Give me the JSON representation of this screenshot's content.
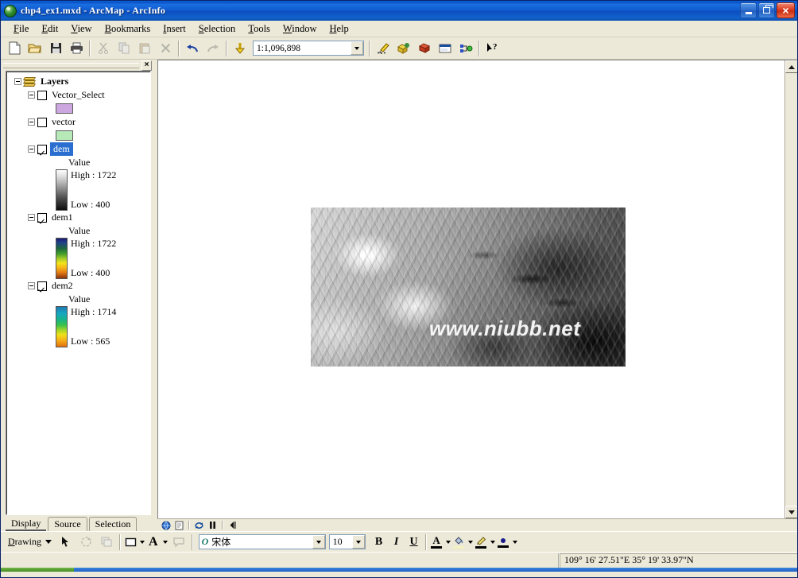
{
  "window": {
    "title": "chp4_ex1.mxd - ArcMap - ArcInfo",
    "icon": "arcmap-globe-icon",
    "minimize_label": "",
    "maximize_label": "",
    "close_label": "×"
  },
  "menubar": {
    "items": [
      {
        "label": "File",
        "accel": "F"
      },
      {
        "label": "Edit",
        "accel": "E"
      },
      {
        "label": "View",
        "accel": "V"
      },
      {
        "label": "Bookmarks",
        "accel": "B"
      },
      {
        "label": "Insert",
        "accel": "I"
      },
      {
        "label": "Selection",
        "accel": "S"
      },
      {
        "label": "Tools",
        "accel": "T"
      },
      {
        "label": "Window",
        "accel": "W"
      },
      {
        "label": "Help",
        "accel": "H"
      }
    ]
  },
  "toolbar": {
    "buttons": [
      {
        "name": "new-document-icon",
        "title": "New"
      },
      {
        "name": "open-folder-icon",
        "title": "Open"
      },
      {
        "name": "save-icon",
        "title": "Save"
      },
      {
        "name": "print-icon",
        "title": "Print"
      },
      {
        "name": "cut-icon",
        "title": "Cut"
      },
      {
        "name": "copy-icon",
        "title": "Copy"
      },
      {
        "name": "paste-icon",
        "title": "Paste"
      },
      {
        "name": "delete-icon",
        "title": "Delete"
      },
      {
        "name": "undo-icon",
        "title": "Undo"
      },
      {
        "name": "redo-icon",
        "title": "Redo"
      },
      {
        "name": "add-data-icon",
        "title": "Add Data"
      }
    ],
    "scale": {
      "label": "map-scale-combo",
      "value": "1:1,096,898"
    },
    "right_buttons": [
      {
        "name": "editor-toolbar-icon",
        "title": "Editor Toolbar"
      },
      {
        "name": "arctoolbox-icon",
        "title": "Show/Hide ArcToolbox Window"
      },
      {
        "name": "command-line-icon",
        "title": "Show/Hide Command Line Window"
      },
      {
        "name": "model-builder-icon",
        "title": "ModelBuilder"
      },
      {
        "name": "whats-this-icon",
        "title": "What's This?"
      }
    ]
  },
  "toc": {
    "close_label": "×",
    "root": {
      "label": "Layers",
      "icon": "layers-icon",
      "expanded": true
    },
    "layers": [
      {
        "name": "Vector_Select",
        "checked": false,
        "selected": false,
        "legend_type": "swatch",
        "swatch_color": "#cda8e0"
      },
      {
        "name": "vector",
        "checked": false,
        "selected": false,
        "legend_type": "swatch",
        "swatch_color": "#b6e8b8"
      },
      {
        "name": "dem",
        "checked": true,
        "selected": true,
        "legend_type": "ramp",
        "value_label": "Value",
        "high_label": "High : 1722",
        "low_label": "Low  : 400",
        "ramp_css": "linear-gradient(180deg,#ffffff 0%,#d9d9d9 18%,#9a9a9a 42%,#4e4e4e 70%,#0d0d0d 100%)"
      },
      {
        "name": "dem1",
        "checked": true,
        "selected": false,
        "legend_type": "ramp",
        "value_label": "Value",
        "high_label": "High : 1722",
        "low_label": "Low  : 400",
        "ramp_css": "linear-gradient(180deg,#1b1b6e 0%,#20408c 10%,#1f6b3a 26%,#3f9c2a 38%,#9ec92a 50%,#f2e41a 62%,#f5b418 74%,#e07a14 86%,#8a3510 100%)"
      },
      {
        "name": "dem2",
        "checked": true,
        "selected": false,
        "legend_type": "ramp",
        "value_label": "Value",
        "high_label": "High : 1714",
        "low_label": "Low  : 565",
        "ramp_css": "linear-gradient(180deg,#1f7ab0 0%,#18a6c4 16%,#17b48a 32%,#3bc04a 46%,#9fd62a 58%,#f0e018 70%,#f5b018 84%,#e2700f 100%)"
      }
    ],
    "tabs": [
      {
        "label": "Display",
        "active": true
      },
      {
        "label": "Source",
        "active": false
      },
      {
        "label": "Selection",
        "active": false
      }
    ]
  },
  "map": {
    "watermark": "www.niubb.net",
    "raster_name": "dem-raster-display",
    "bottom_buttons": [
      {
        "name": "data-view-icon",
        "title": "Data View"
      },
      {
        "name": "layout-view-icon",
        "title": "Layout View"
      },
      {
        "name": "refresh-icon",
        "title": "Refresh View"
      },
      {
        "name": "pause-drawing-icon",
        "title": "Pause Drawing"
      },
      {
        "name": "scroll-left-icon",
        "title": "Scroll Left"
      }
    ]
  },
  "drawbar": {
    "menu_label": "Drawing",
    "menu_accel": "D",
    "tools": [
      {
        "name": "select-elements-icon",
        "title": "Select Elements"
      },
      {
        "name": "rotate-element-icon",
        "title": "Rotate Element"
      },
      {
        "name": "group-elements-icon",
        "title": "Group"
      },
      {
        "name": "new-rectangle-icon",
        "title": "New Rectangle"
      },
      {
        "name": "new-text-icon",
        "title": "New Text"
      },
      {
        "name": "callout-icon",
        "title": "Callout"
      }
    ],
    "font": {
      "value": "宋体",
      "badge": "O"
    },
    "size": {
      "value": "10"
    },
    "bold_label": "B",
    "italic_label": "I",
    "underline_label": "U",
    "color_buttons": [
      {
        "name": "font-color-icon",
        "glyph": "A",
        "color": "#000000"
      },
      {
        "name": "fill-color-icon",
        "glyph": "",
        "color": "#f2f2c0"
      },
      {
        "name": "line-color-icon",
        "glyph": "",
        "color": "#000000"
      },
      {
        "name": "marker-color-icon",
        "glyph": "",
        "color": "#1a1a8c"
      }
    ]
  },
  "statusbar": {
    "message": "",
    "coordinates": "109° 16' 27.51\"E   35° 19' 33.97\"N"
  }
}
